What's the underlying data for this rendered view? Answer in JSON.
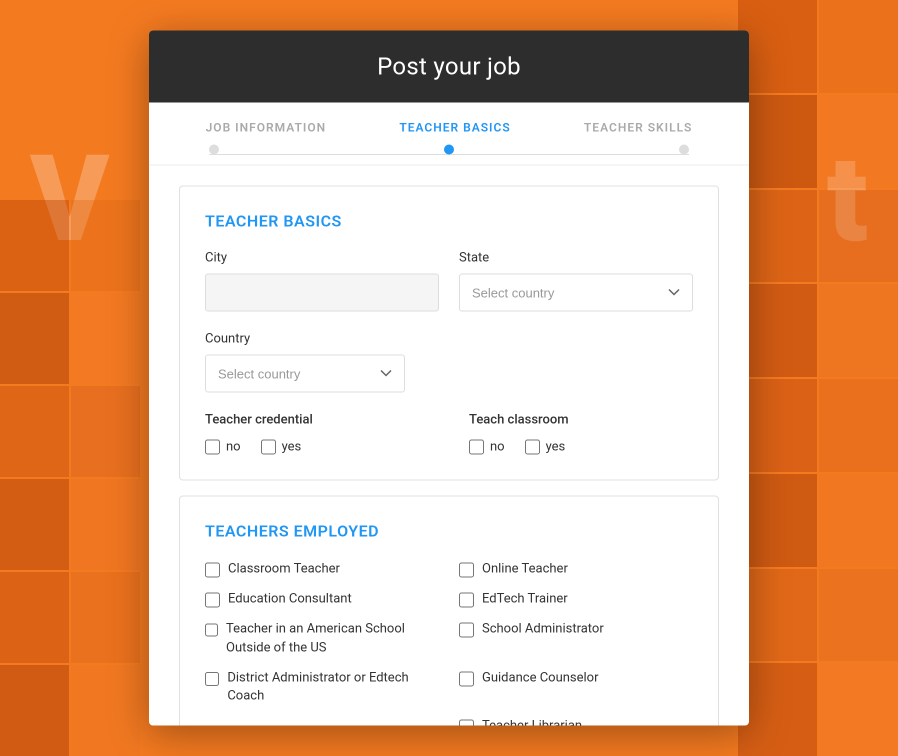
{
  "background": {
    "left_letter": "V",
    "right_letter": "t"
  },
  "modal": {
    "title": "Post your job",
    "tabs": [
      {
        "id": "job-information",
        "label": "JOB INFORMATION",
        "active": false
      },
      {
        "id": "teacher-basics",
        "label": "TEACHER BASICS",
        "active": true
      },
      {
        "id": "teacher-skills",
        "label": "TEACHER SKILLS",
        "active": false
      }
    ]
  },
  "teacher_basics": {
    "section_title": "TEACHER BASICS",
    "city_label": "City",
    "city_placeholder": "",
    "state_label": "State",
    "state_placeholder": "Select country",
    "country_label": "Country",
    "country_placeholder": "Select country",
    "teacher_credential_label": "Teacher credential",
    "teach_classroom_label": "Teach classroom",
    "no_label": "no",
    "yes_label": "yes"
  },
  "teachers_employed": {
    "section_title": "TEACHERS EMPLOYED",
    "items_left": [
      "Classroom Teacher",
      "Education Consultant",
      "Teacher in an American School Outside of the US",
      "District Administrator or Edtech Coach"
    ],
    "items_right": [
      "Online Teacher",
      "EdTech Trainer",
      "School Administrator",
      "Guidance Counselor",
      "Teacher Librarian"
    ]
  },
  "colors": {
    "accent_blue": "#2196F3",
    "header_bg": "#2D2D2D",
    "orange_bg": "#F47A20"
  }
}
